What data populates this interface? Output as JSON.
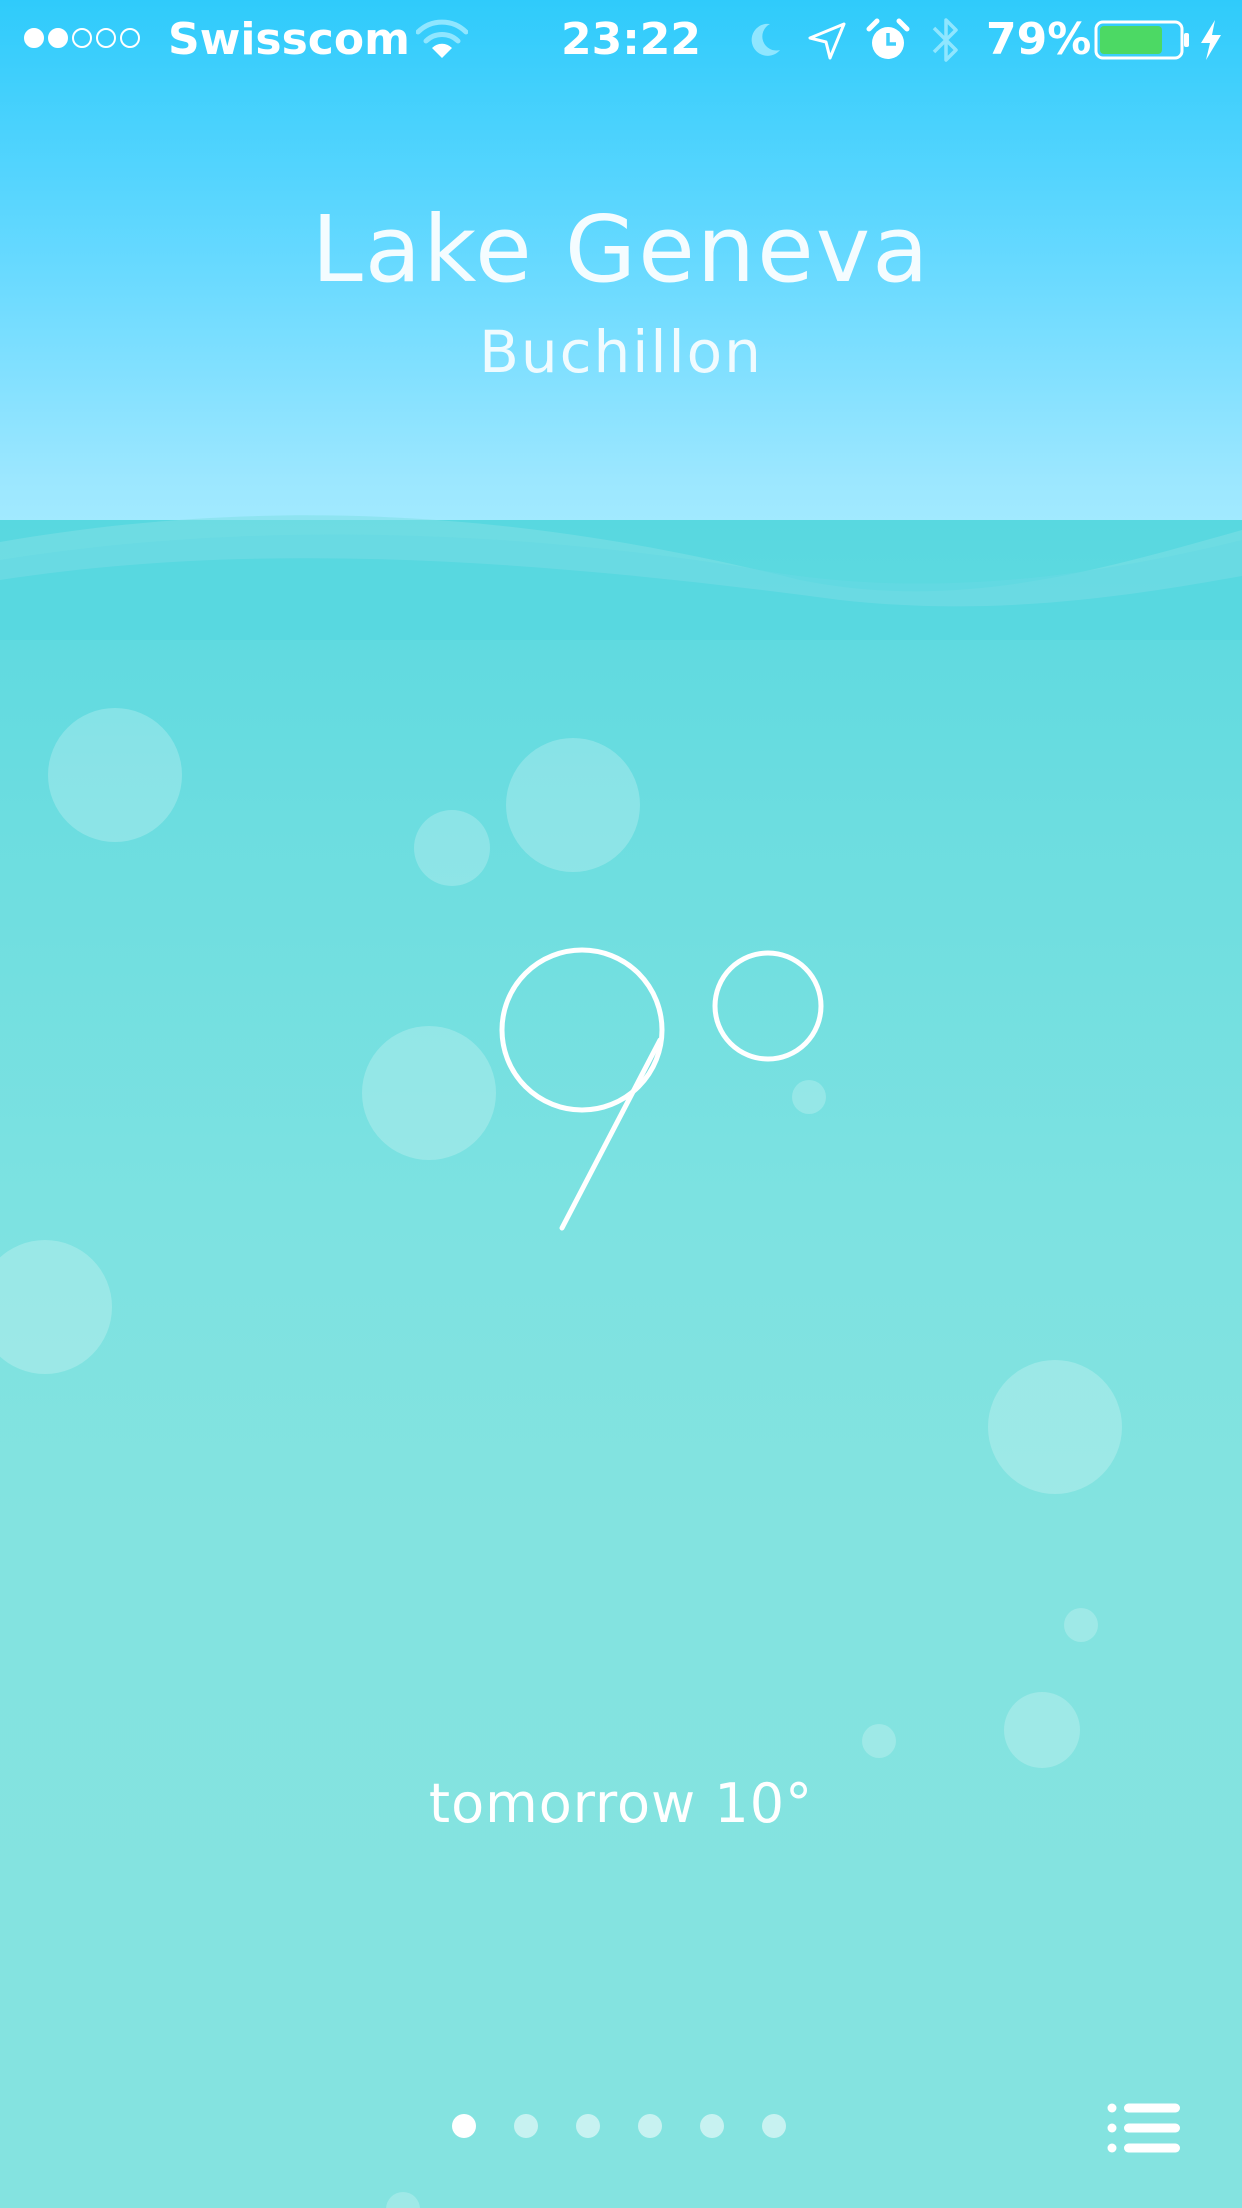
{
  "status_bar": {
    "signal_strength": 2,
    "signal_max": 5,
    "carrier": "Swisscom",
    "time": "23:22",
    "battery_percent_label": "79%",
    "battery_level": 0.79,
    "icons": [
      "wifi-icon",
      "moon-icon",
      "location-arrow-icon",
      "alarm-clock-icon",
      "bluetooth-icon",
      "battery-icon",
      "charging-bolt-icon"
    ]
  },
  "location": {
    "title": "Lake Geneva",
    "subtitle": "Buchillon"
  },
  "current": {
    "temperature": "9°"
  },
  "forecast": {
    "tomorrow_label": "tomorrow 10°"
  },
  "pager": {
    "page_count": 6,
    "active_page": 1
  },
  "colors": {
    "sky_top": "#2fcbfb",
    "sky_bottom": "#aef0ff",
    "water": "#83e2e0",
    "battery_fill": "#4cd964"
  },
  "menu_icon": "list-icon"
}
